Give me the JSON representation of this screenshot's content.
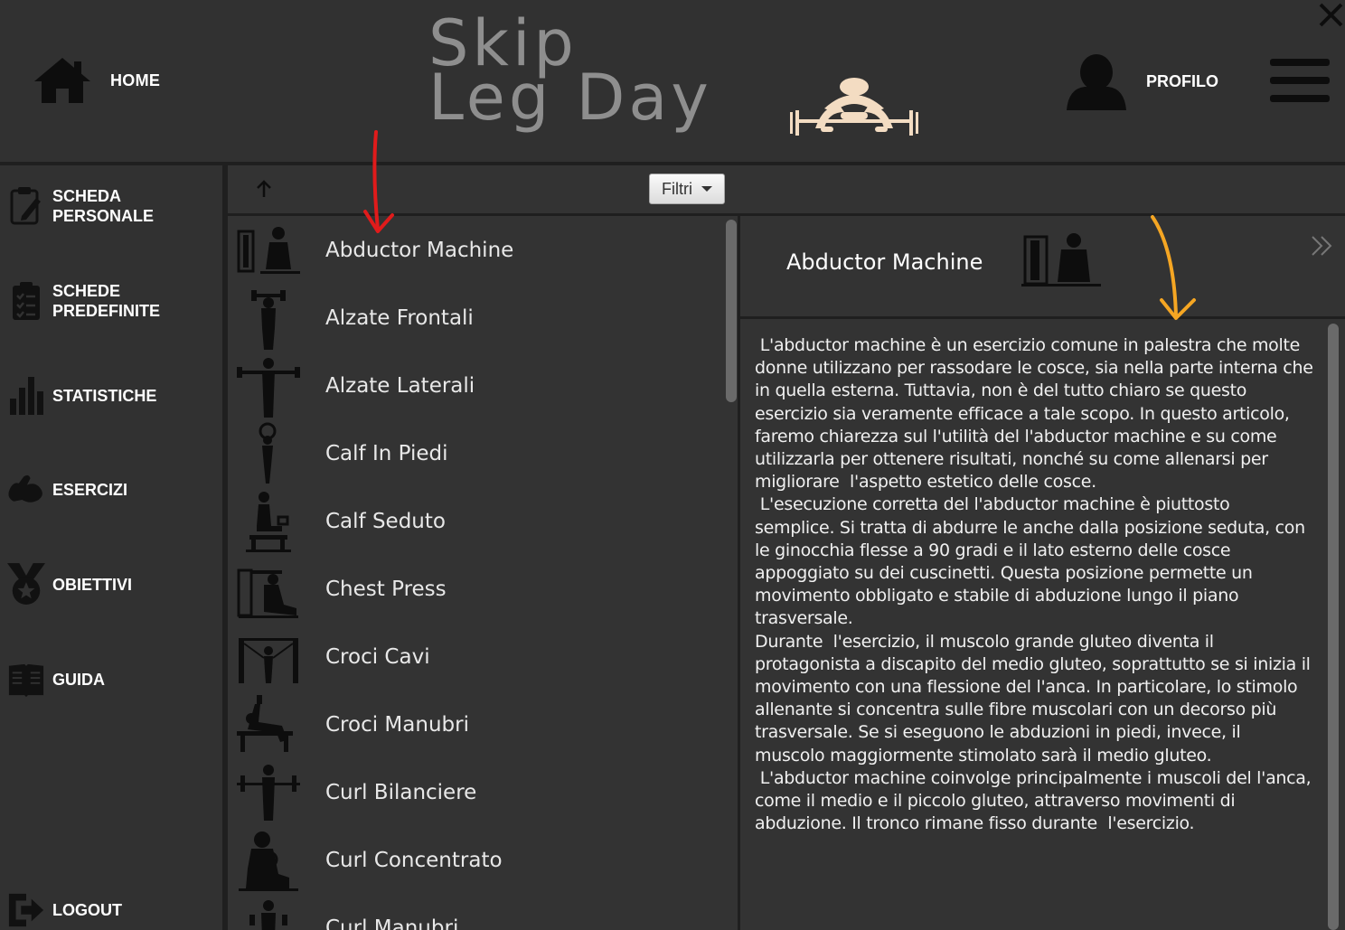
{
  "header": {
    "home_label": "HOME",
    "logo_line1": "Skip",
    "logo_line2": "Leg Day",
    "profile_label": "PROFILO",
    "logo_accent_color": "#f3dcc2"
  },
  "sidebar": {
    "items": [
      {
        "label": "SCHEDA\nPERSONALE",
        "icon": "clipboard-edit-icon"
      },
      {
        "label": "SCHEDE\nPREDEFINITE",
        "icon": "checklist-icon"
      },
      {
        "label": "STATISTICHE",
        "icon": "bar-chart-icon"
      },
      {
        "label": "ESERCIZI",
        "icon": "muscle-icon"
      },
      {
        "label": "OBIETTIVI",
        "icon": "medal-icon"
      },
      {
        "label": "GUIDA",
        "icon": "book-icon"
      },
      {
        "label": "LOGOUT",
        "icon": "logout-icon"
      }
    ]
  },
  "toolbar": {
    "filter_label": "Filtri"
  },
  "exercises": [
    "Abductor Machine",
    "Alzate Frontali",
    "Alzate Laterali",
    "Calf In Piedi",
    "Calf Seduto",
    "Chest Press",
    "Croci Cavi",
    "Croci Manubri",
    "Curl Bilanciere",
    "Curl Concentrato",
    "Curl Manubri"
  ],
  "detail": {
    "title": "Abductor Machine",
    "paragraphs": [
      " L'abductor machine è un esercizio comune in palestra che molte donne utilizzano per rassodare le cosce, sia nella parte interna che in quella esterna. Tuttavia, non è del tutto chiaro se questo esercizio sia veramente efficace a tale scopo. In questo articolo, faremo chiarezza sul l'utilità del l'abductor machine e su come utilizzarla per ottenere risultati, nonché su come allenarsi per migliorare  l'aspetto estetico delle cosce.",
      " L'esecuzione corretta del l'abductor machine è piuttosto semplice. Si tratta di abdurre le anche dalla posizione seduta, con le ginocchia flesse a 90 gradi e il lato esterno delle cosce appoggiato su dei cuscinetti. Questa posizione permette un movimento obbligato e stabile di abduzione lungo il piano trasversale.",
      "Durante  l'esercizio, il muscolo grande gluteo diventa il protagonista a discapito del medio gluteo, soprattutto se si inizia il movimento con una flessione del l'anca. In particolare, lo stimolo allenante si concentra sulle fibre muscolari con un decorso più trasversale. Se si eseguono le abduzioni in piedi, invece, il muscolo maggiormente stimolato sarà il medio gluteo.",
      " L'abductor machine coinvolge principalmente i muscoli del l'anca, come il medio e il piccolo gluteo, attraverso movimenti di abduzione. Il tronco rimane fisso durante  l'esercizio."
    ]
  },
  "annotations": {
    "red_arrow_color": "#e01b1b",
    "orange_arrow_color": "#f5a623"
  }
}
